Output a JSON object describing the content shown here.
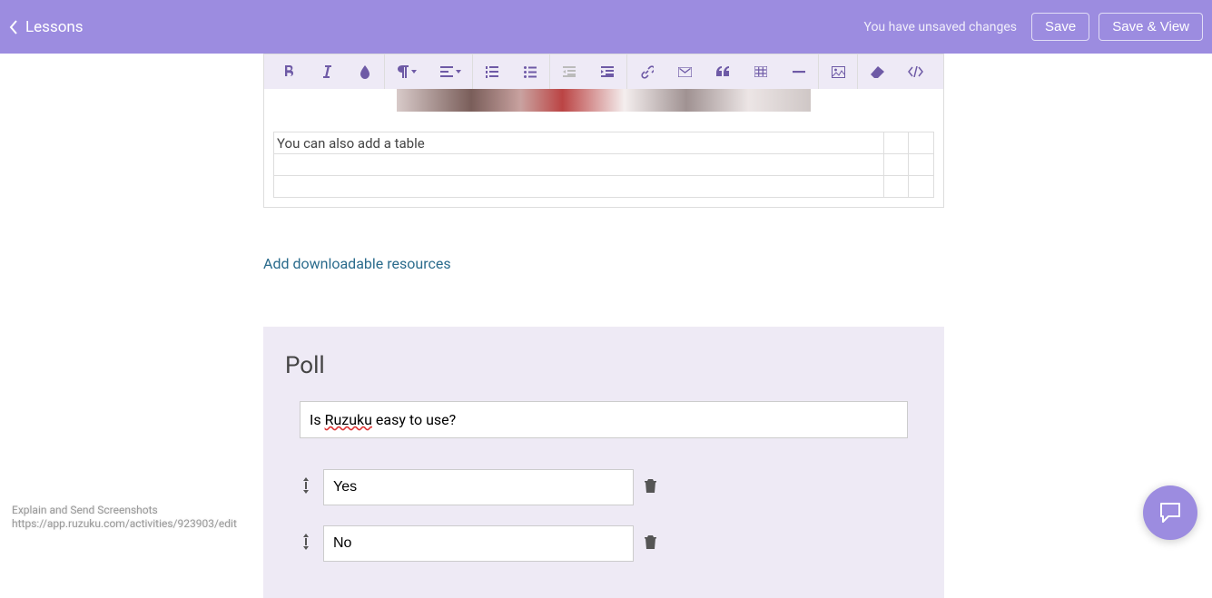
{
  "header": {
    "back_label": "Lessons",
    "unsaved_text": "You have unsaved changes",
    "save_label": "Save",
    "save_view_label": "Save & View"
  },
  "editor": {
    "table_cell_text": "You can also add a table"
  },
  "resources": {
    "add_label": "Add downloadable resources"
  },
  "poll": {
    "title": "Poll",
    "question_prefix": "Is ",
    "question_mid": "Ruzuku",
    "question_suffix": " easy to use?",
    "options": [
      "Yes",
      "No"
    ]
  },
  "footer": {
    "line1": "Explain and Send Screenshots",
    "line2": "https://app.ruzuku.com/activities/923903/edit"
  }
}
